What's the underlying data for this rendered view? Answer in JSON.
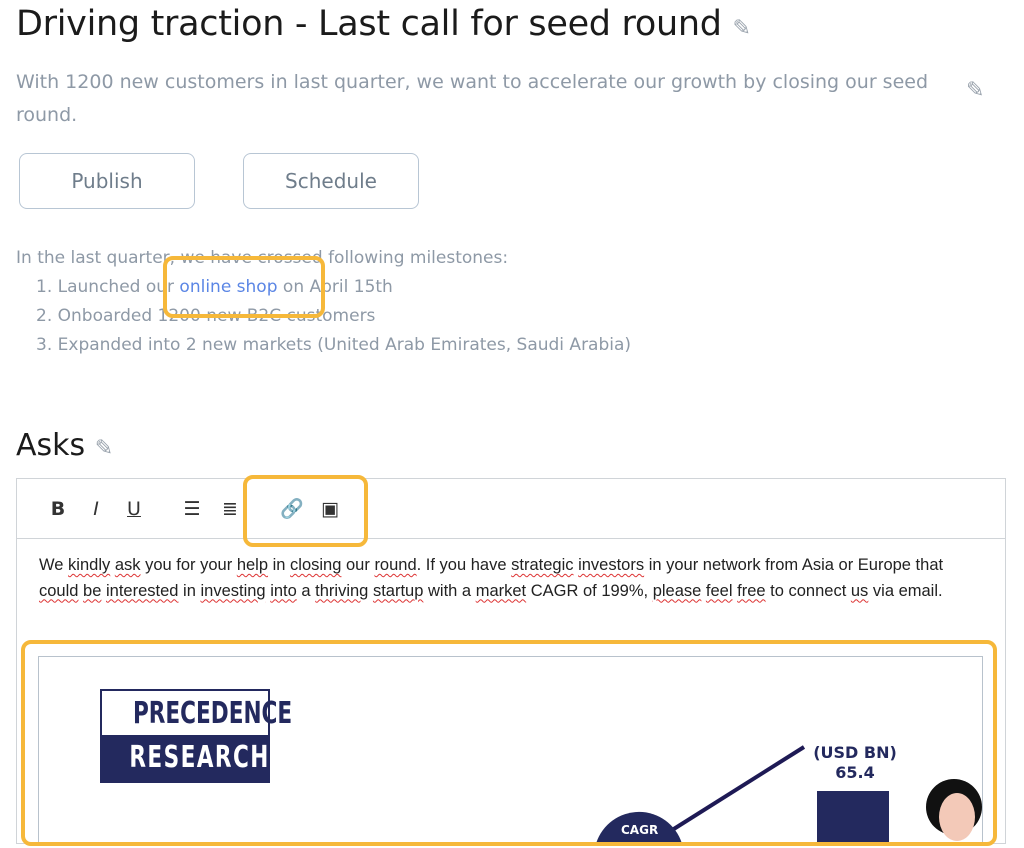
{
  "header": {
    "title": "Driving traction - Last call for seed round",
    "subtitle": "With 1200 new customers in last quarter, we want to accelerate our growth by closing our seed round."
  },
  "actions": {
    "publish": "Publish",
    "schedule": "Schedule"
  },
  "intro": {
    "lead": "In the last quarter, we have crossed following milestones:",
    "items": [
      {
        "num": "1.",
        "before": "Launched our ",
        "link": "online shop",
        "after": " on April 15th"
      },
      {
        "num": "2.",
        "text": "Onboarded 1200 new B2C customers"
      },
      {
        "num": "3.",
        "text": "Expanded into 2 new markets (United Arab Emirates, Saudi Arabia)"
      }
    ]
  },
  "asks": {
    "heading": "Asks",
    "toolbar": {
      "bold": "B",
      "italic": "I",
      "underline": "U"
    },
    "paragraph": [
      [
        "We ",
        0
      ],
      [
        "kindly",
        1
      ],
      [
        " ",
        0
      ],
      [
        "ask",
        1
      ],
      [
        " you for your ",
        0
      ],
      [
        "help",
        1
      ],
      [
        " in ",
        0
      ],
      [
        "closing",
        1
      ],
      [
        " our ",
        0
      ],
      [
        "round",
        1
      ],
      [
        ". If you have ",
        0
      ],
      [
        "strategic",
        1
      ],
      [
        " ",
        0
      ],
      [
        "investors",
        1
      ],
      [
        " in your network from Asia or Europe that ",
        0
      ],
      [
        "could",
        1
      ],
      [
        " ",
        0
      ],
      [
        "be",
        1
      ],
      [
        " ",
        0
      ],
      [
        "interested",
        1
      ],
      [
        " in ",
        0
      ],
      [
        "investing",
        1
      ],
      [
        " ",
        0
      ],
      [
        "into",
        1
      ],
      [
        " a ",
        0
      ],
      [
        "thriving",
        1
      ],
      [
        " ",
        0
      ],
      [
        "startup",
        1
      ],
      [
        " with a ",
        0
      ],
      [
        "market",
        1
      ],
      [
        " CAGR of 199%, ",
        0
      ],
      [
        "please",
        1
      ],
      [
        " ",
        0
      ],
      [
        "feel",
        1
      ],
      [
        " ",
        0
      ],
      [
        "free",
        1
      ],
      [
        " to connect ",
        0
      ],
      [
        "us",
        1
      ],
      [
        " via email.",
        0
      ]
    ],
    "image": {
      "logo_top": "PRECEDENCE",
      "logo_bottom": "RESEARCH",
      "unit": "(USD BN)",
      "value": "65.4",
      "badge": "CAGR"
    }
  },
  "colors": {
    "highlight": "#f6b83a",
    "link": "#5b86e5",
    "navy": "#23295e"
  }
}
